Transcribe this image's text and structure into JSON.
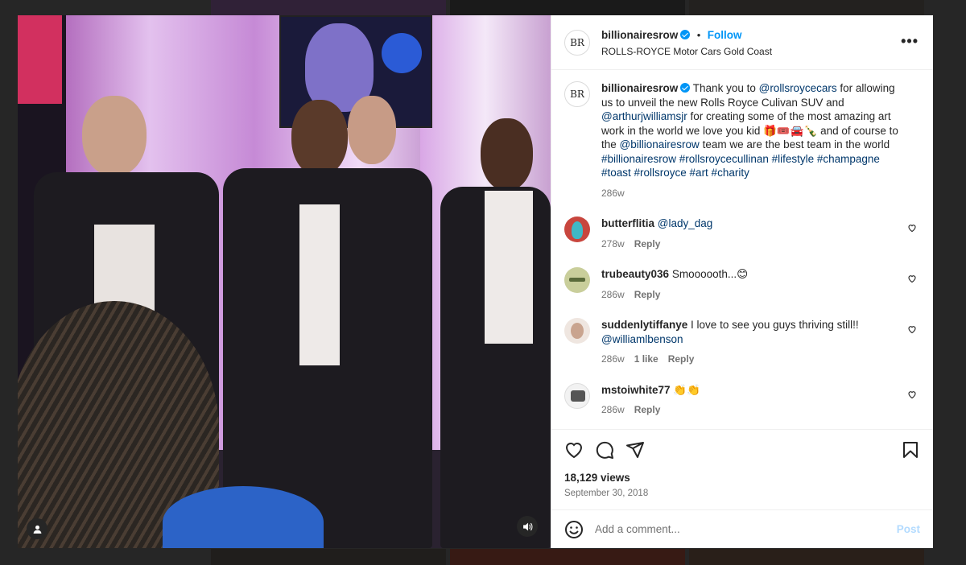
{
  "post": {
    "username": "billionairesrow",
    "avatar_text": "BR",
    "follow_label": "Follow",
    "location": "ROLLS-ROYCE Motor Cars Gold Coast",
    "more_label": "•••"
  },
  "caption": {
    "username": "billionairesrow",
    "text_1": "Thank you to",
    "mention_1": "@rollsroycecars",
    "text_2": "for allowing us to unveil the new Rolls Royce Culivan SUV and",
    "mention_2": "@arthurjwilliamsjr",
    "text_3": "for creating some of the most amazing art work in the world we love you kid 🎁🎟️🚘🍾 and of course to the",
    "mention_3": "@billionairesrow",
    "text_4": "team we are the best team in the world",
    "hashtags": "#billionairesrow #rollsroycecullinan #lifestyle #champagne #toast #rollsroyce #art #charity",
    "time": "286w"
  },
  "comments": [
    {
      "username": "butterflitia",
      "mention": "@lady_dag",
      "text": "",
      "time": "278w",
      "likes": "",
      "reply": "Reply"
    },
    {
      "username": "trubeauty036",
      "mention": "",
      "text": "Smoooooth...😊",
      "time": "286w",
      "likes": "",
      "reply": "Reply"
    },
    {
      "username": "suddenlytiffanye",
      "mention": "@williamlbenson",
      "text": "I love to see you guys thriving still!!",
      "time": "286w",
      "likes": "1 like",
      "reply": "Reply"
    },
    {
      "username": "mstoiwhite77",
      "mention": "",
      "text": "👏👏",
      "time": "286w",
      "likes": "",
      "reply": "Reply"
    }
  ],
  "stats": {
    "views": "18,129 views",
    "date": "September 30, 2018"
  },
  "composer": {
    "placeholder": "Add a comment...",
    "post_label": "Post"
  },
  "icons": {
    "like": "heart-icon",
    "comment": "comment-icon",
    "share": "share-icon",
    "save": "bookmark-icon",
    "emoji": "emoji-icon",
    "user": "user-tag-icon",
    "sound": "sound-icon"
  },
  "colors": {
    "link": "#00376b",
    "follow": "#0095f6",
    "post_disabled": "#b3dbff"
  }
}
